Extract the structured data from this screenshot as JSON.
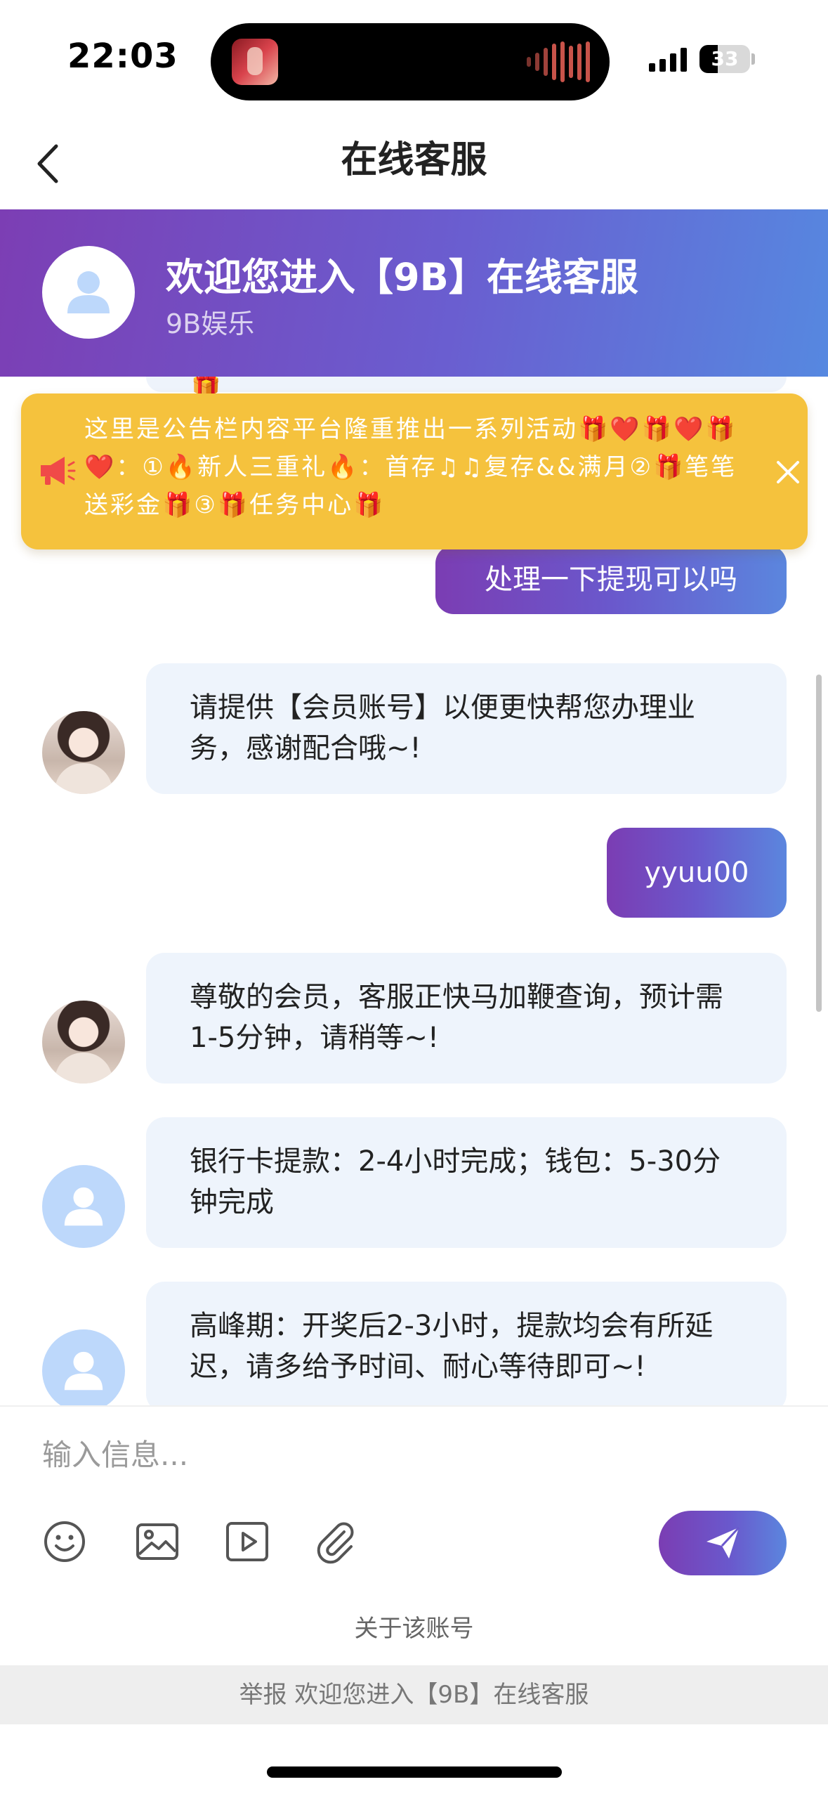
{
  "status_bar": {
    "time": "22:03",
    "battery_level": "33"
  },
  "nav": {
    "title": "在线客服"
  },
  "banner": {
    "title": "欢迎您进入【9B】在线客服",
    "subtitle": "9B娱乐"
  },
  "notice": {
    "text": "这里是公告栏内容平台隆重推出一系列活动🎁❤️🎁❤️🎁❤️：①🔥新人三重礼🔥：首存♫♫复存&&满月②🎁笔笔送彩金🎁③🎁任务中心🎁"
  },
  "messages": [
    {
      "from": "user",
      "text": "处理一下提现可以吗"
    },
    {
      "from": "agent",
      "avatar": "photo",
      "text": "请提供【会员账号】以便更快帮您办理业务，感谢配合哦~!"
    },
    {
      "from": "user",
      "text": "yyuu00"
    },
    {
      "from": "agent",
      "avatar": "photo",
      "text": "尊敬的会员，客服正快马加鞭查询，预计需1-5分钟，请稍等~!"
    },
    {
      "from": "agent",
      "avatar": "default",
      "text": "银行卡提款：2-4小时完成；钱包：5-30分钟完成"
    },
    {
      "from": "agent",
      "avatar": "default",
      "text": "高峰期：开奖后2-3小时，提款均会有所延迟，请多给予时间、耐心等待即可~!"
    }
  ],
  "composer": {
    "placeholder": "输入信息...",
    "tools": [
      "emoji-icon",
      "image-icon",
      "video-icon",
      "attachment-icon"
    ],
    "account_link": "关于该账号"
  },
  "report_bar": {
    "text": "举报 欢迎您进入【9B】在线客服"
  },
  "colors": {
    "accent_start": "#7b3db3",
    "accent_end": "#5b86de",
    "notice_bg": "#f5c23d",
    "agent_bubble": "#eef4fc"
  }
}
